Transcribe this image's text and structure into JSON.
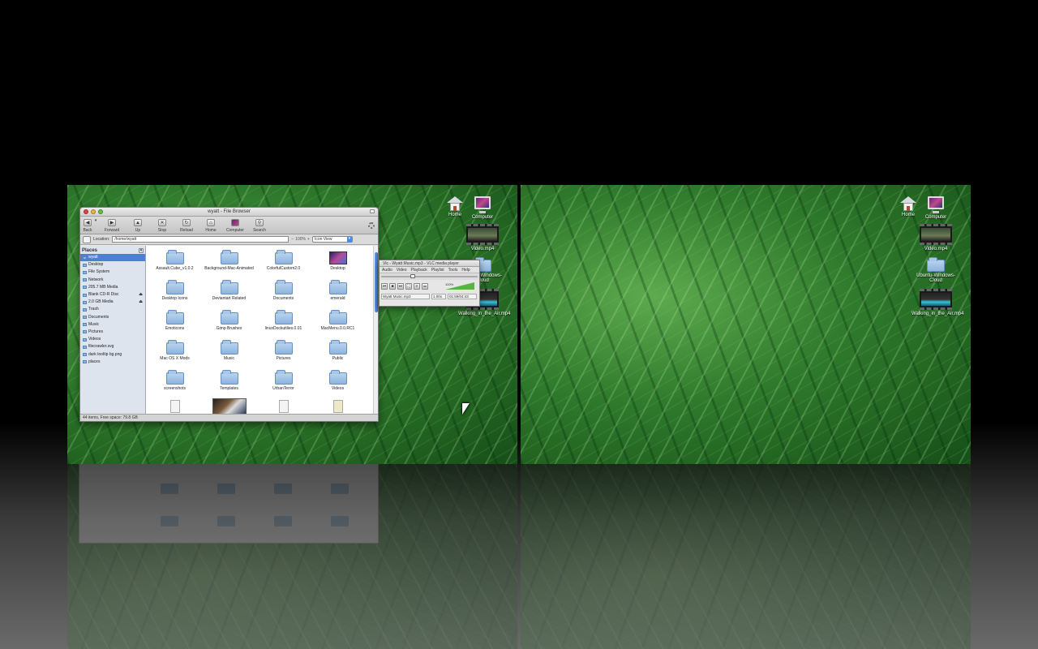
{
  "workspaces": [
    {
      "desktop_icons": [
        {
          "label": "Home",
          "icon": "home-icon"
        },
        {
          "label": "Computer",
          "icon": "computer-icon"
        },
        {
          "label": "Video.mp4",
          "icon": "video-thumbnail-icon"
        },
        {
          "label": "Ubuntu-Windows-Cloud",
          "icon": "folder-icon"
        },
        {
          "label": "Walking_in_the_Air.mp4",
          "icon": "video-thumbnail-icon"
        }
      ]
    },
    {
      "desktop_icons": [
        {
          "label": "Home",
          "icon": "home-icon"
        },
        {
          "label": "Computer",
          "icon": "computer-icon"
        },
        {
          "label": "Video.mp4",
          "icon": "video-thumbnail-icon"
        },
        {
          "label": "Ubuntu-Windows-Cloud",
          "icon": "folder-icon"
        },
        {
          "label": "Walking_in_the_Air.mp4",
          "icon": "video-thumbnail-icon"
        }
      ]
    }
  ],
  "file_browser": {
    "title": "wyatt - File Browser",
    "toolbar": [
      {
        "label": "Back",
        "icon": "back-arrow-icon"
      },
      {
        "label": "Forward",
        "icon": "forward-arrow-icon"
      },
      {
        "label": "Up",
        "icon": "up-arrow-icon"
      },
      {
        "label": "Stop",
        "icon": "stop-icon"
      },
      {
        "label": "Reload",
        "icon": "reload-icon"
      },
      {
        "label": "Home",
        "icon": "home-icon"
      },
      {
        "label": "Computer",
        "icon": "computer-icon"
      },
      {
        "label": "Search",
        "icon": "search-icon"
      }
    ],
    "location_label": "Location:",
    "location_value": "/home/wyatt",
    "zoom_level": "100%",
    "view_mode": "Icon View",
    "sidebar_title": "Places",
    "sidebar_items": [
      {
        "label": "wyatt",
        "selected": true
      },
      {
        "label": "Desktop"
      },
      {
        "label": "File System"
      },
      {
        "label": "Network"
      },
      {
        "label": "205.7 MB Media"
      },
      {
        "label": "Blank CD-R Disc",
        "eject": true
      },
      {
        "label": "2.0 GB Media",
        "eject": true
      },
      {
        "label": "Trash"
      },
      {
        "label": "Documents"
      },
      {
        "label": "Music"
      },
      {
        "label": "Pictures"
      },
      {
        "label": "Videos"
      },
      {
        "label": "filecrawler.svg"
      },
      {
        "label": "dark tooltip bg.png"
      },
      {
        "label": "places"
      }
    ],
    "items": [
      {
        "label": "Assault.Cube_v1.0.2",
        "kind": "folder"
      },
      {
        "label": "Background-Mac-Animated",
        "kind": "folder"
      },
      {
        "label": "ColorfulCustom2.0",
        "kind": "folder"
      },
      {
        "label": "Desktop",
        "kind": "wallpaper"
      },
      {
        "label": "Desktop Icons",
        "kind": "folder"
      },
      {
        "label": "Deviantart Related",
        "kind": "folder"
      },
      {
        "label": "Documents",
        "kind": "folder"
      },
      {
        "label": "emerald",
        "kind": "folder"
      },
      {
        "label": "Emoticons",
        "kind": "folder"
      },
      {
        "label": "Gimp Brushes",
        "kind": "folder"
      },
      {
        "label": "linuxDockutilies.0.01",
        "kind": "folder"
      },
      {
        "label": "MacMenu.0.0.RC1",
        "kind": "folder"
      },
      {
        "label": "Mac OS X Mods",
        "kind": "folder"
      },
      {
        "label": "Music",
        "kind": "folder"
      },
      {
        "label": "Pictures",
        "kind": "folder"
      },
      {
        "label": "Public",
        "kind": "folder"
      },
      {
        "label": "screenshots",
        "kind": "folder"
      },
      {
        "label": "Templates",
        "kind": "folder"
      },
      {
        "label": "UrbanTerror",
        "kind": "folder"
      },
      {
        "label": "Videos",
        "kind": "folder"
      }
    ],
    "status": "44 items, Free space: 79.8 GB"
  },
  "vlc": {
    "title": "Vlc - Wyatt Music.mp3 - VLC media player",
    "menu": [
      "Audio",
      "Video",
      "Playback",
      "Playlist",
      "Tools",
      "Help"
    ],
    "volume": "100%",
    "file": "Wyatt Music.mp3",
    "speed": "1.00x",
    "time": "01:59/04:43"
  }
}
